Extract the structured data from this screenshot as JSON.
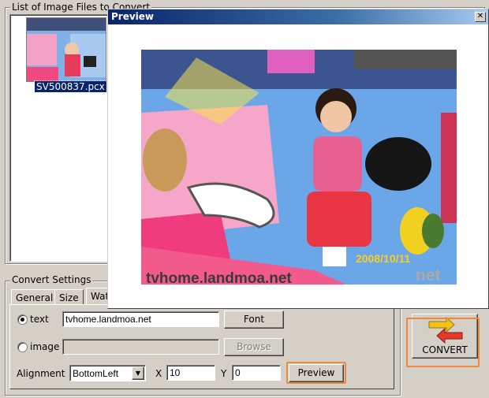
{
  "file_list": {
    "title": "List of Image Files to Convert",
    "files": [
      {
        "name": "SV500837.pcx"
      }
    ]
  },
  "convert_settings": {
    "title": "Convert Settings",
    "tabs": [
      "General",
      "Size",
      "Wat"
    ],
    "text_option_label": "text",
    "text_value": "tvhome.landmoa.net",
    "font_button": "Font",
    "image_option_label": "image",
    "image_value": "",
    "browse_button": "Browse",
    "alignment_label": "Alignment",
    "alignment_value": "BottomLeft",
    "x_label": "X",
    "x_value": "10",
    "y_label": "Y",
    "y_value": "0",
    "preview_button": "Preview"
  },
  "convert_button": "CONVERT",
  "preview_window": {
    "title": "Preview",
    "close_glyph": "✕",
    "photo_date_stamp": "2008/10/11",
    "photo_watermark": "tvhome.landmoa.net",
    "photo_watermark_ghost": "net"
  },
  "colors": {
    "highlight": "#f0883c",
    "stamp": "#f5d020",
    "titlebar_start": "#0a246a"
  }
}
